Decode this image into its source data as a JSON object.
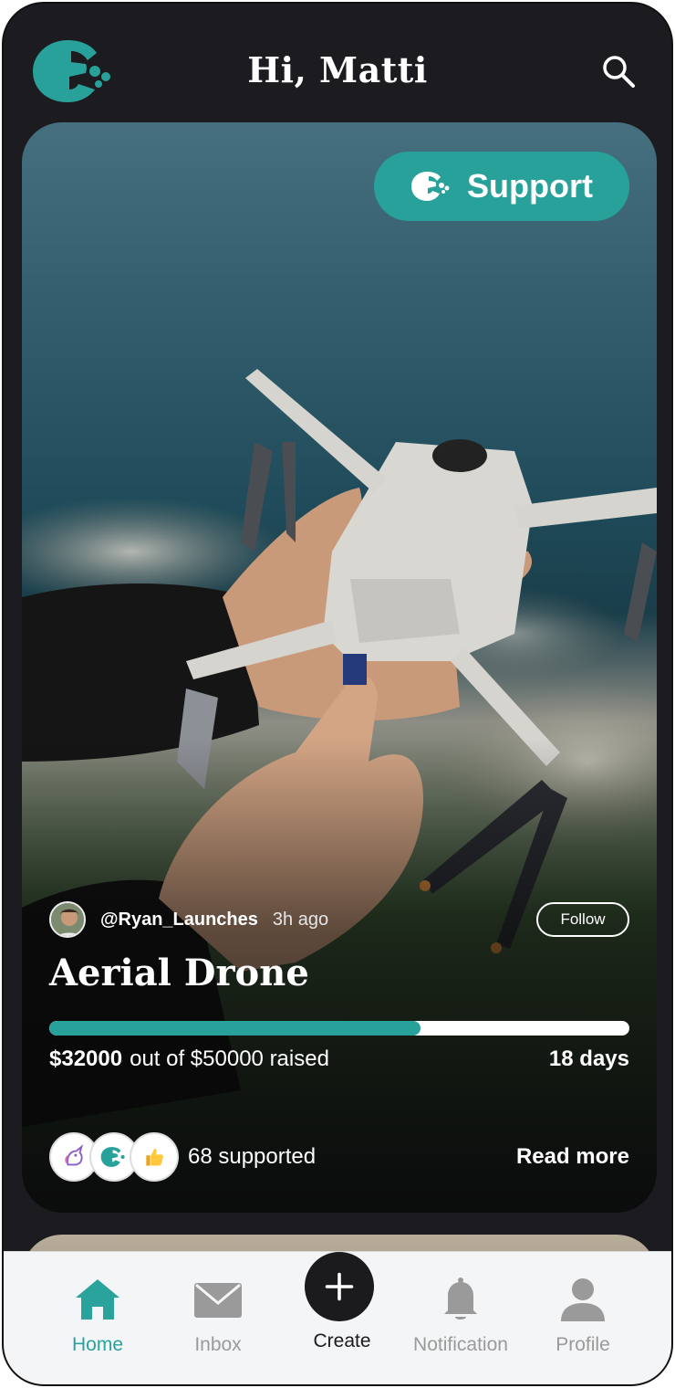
{
  "header": {
    "logo_icon": "app-logo-icon",
    "greeting": "Hi, Matti",
    "search_icon": "search-icon"
  },
  "card": {
    "support_label": "Support",
    "author": {
      "handle": "@Ryan_Launches",
      "time_ago": "3h ago",
      "follow_label": "Follow"
    },
    "title": "Aerial Drone",
    "progress_fraction": 0.64,
    "raised_amount": "$32000",
    "raised_suffix": "out of $50000 raised",
    "days_left": "18 days",
    "supported_count": "68 supported",
    "read_more_label": "Read more"
  },
  "nav": {
    "items": [
      {
        "label": "Home",
        "icon": "home-icon",
        "active": true
      },
      {
        "label": "Inbox",
        "icon": "mail-icon",
        "active": false
      },
      {
        "label": "Create",
        "icon": "plus-icon",
        "active": false
      },
      {
        "label": "Notification",
        "icon": "bell-icon",
        "active": false
      },
      {
        "label": "Profile",
        "icon": "user-icon",
        "active": false
      }
    ]
  },
  "colors": {
    "accent": "#27a19a",
    "background": "#1c1b1f",
    "nav_bg": "#f4f5f7"
  }
}
